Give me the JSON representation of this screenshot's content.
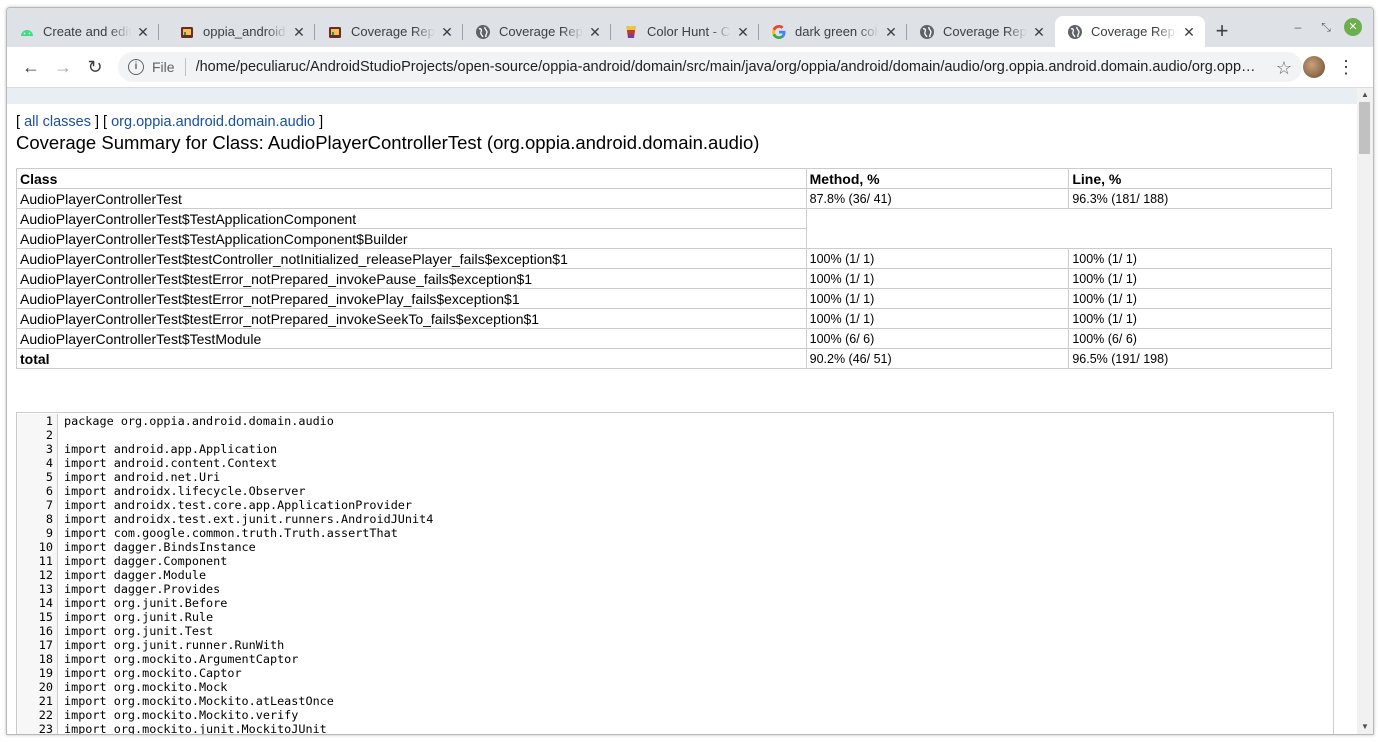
{
  "tabs": [
    {
      "title": "Create and edit",
      "icon": "android-icon"
    },
    {
      "title": "oppia_android",
      "icon": "oppia-icon"
    },
    {
      "title": "Coverage Report",
      "icon": "oppia-icon"
    },
    {
      "title": "Coverage Report",
      "icon": "globe-icon"
    },
    {
      "title": "Color Hunt - Color",
      "icon": "colorhunt-icon"
    },
    {
      "title": "dark green color",
      "icon": "google-icon"
    },
    {
      "title": "Coverage Report",
      "icon": "globe-icon"
    },
    {
      "title": "Coverage Report",
      "icon": "globe-icon",
      "active": true
    }
  ],
  "toolbar": {
    "file_label": "File",
    "url": "/home/peculiaruc/AndroidStudioProjects/open-source/oppia-android/domain/src/main/java/org/oppia/android/domain/audio/org.oppia.android.domain.audio/org.oppia.android.domain.audio.AudioPlayerControllerTest.html"
  },
  "breadcrumb": {
    "open": "[",
    "all_classes": "all classes",
    "mid": "] [",
    "package": "org.oppia.android.domain.audio",
    "close": "]"
  },
  "page_title": "Coverage Summary for Class: AudioPlayerControllerTest (org.oppia.android.domain.audio)",
  "table": {
    "headers": {
      "class": "Class",
      "method": "Method, %",
      "line": "Line, %"
    },
    "rows": [
      {
        "class": "AudioPlayerControllerTest",
        "method": "87.8% (36/ 41)",
        "line": "96.3% (181/ 188)"
      },
      {
        "class": "AudioPlayerControllerTest$TestApplicationComponent",
        "method": "",
        "line": ""
      },
      {
        "class": "AudioPlayerControllerTest$TestApplicationComponent$Builder",
        "method": "",
        "line": ""
      },
      {
        "class": "AudioPlayerControllerTest$testController_notInitialized_releasePlayer_fails$exception$1",
        "method": "100% (1/ 1)",
        "line": "100% (1/ 1)"
      },
      {
        "class": "AudioPlayerControllerTest$testError_notPrepared_invokePause_fails$exception$1",
        "method": "100% (1/ 1)",
        "line": "100% (1/ 1)"
      },
      {
        "class": "AudioPlayerControllerTest$testError_notPrepared_invokePlay_fails$exception$1",
        "method": "100% (1/ 1)",
        "line": "100% (1/ 1)"
      },
      {
        "class": "AudioPlayerControllerTest$testError_notPrepared_invokeSeekTo_fails$exception$1",
        "method": "100% (1/ 1)",
        "line": "100% (1/ 1)"
      },
      {
        "class": "AudioPlayerControllerTest$TestModule",
        "method": "100% (6/ 6)",
        "line": "100% (6/ 6)"
      }
    ],
    "total": {
      "class": "total",
      "method": "90.2% (46/ 51)",
      "line": "96.5% (191/ 198)"
    }
  },
  "code_lines": [
    {
      "n": "1",
      "text": "package org.oppia.android.domain.audio"
    },
    {
      "n": "2",
      "text": ""
    },
    {
      "n": "3",
      "text": "import android.app.Application"
    },
    {
      "n": "4",
      "text": "import android.content.Context"
    },
    {
      "n": "5",
      "text": "import android.net.Uri"
    },
    {
      "n": "6",
      "text": "import androidx.lifecycle.Observer"
    },
    {
      "n": "7",
      "text": "import androidx.test.core.app.ApplicationProvider"
    },
    {
      "n": "8",
      "text": "import androidx.test.ext.junit.runners.AndroidJUnit4"
    },
    {
      "n": "9",
      "text": "import com.google.common.truth.Truth.assertThat"
    },
    {
      "n": "10",
      "text": "import dagger.BindsInstance"
    },
    {
      "n": "11",
      "text": "import dagger.Component"
    },
    {
      "n": "12",
      "text": "import dagger.Module"
    },
    {
      "n": "13",
      "text": "import dagger.Provides"
    },
    {
      "n": "14",
      "text": "import org.junit.Before"
    },
    {
      "n": "15",
      "text": "import org.junit.Rule"
    },
    {
      "n": "16",
      "text": "import org.junit.Test"
    },
    {
      "n": "17",
      "text": "import org.junit.runner.RunWith"
    },
    {
      "n": "18",
      "text": "import org.mockito.ArgumentCaptor"
    },
    {
      "n": "19",
      "text": "import org.mockito.Captor"
    },
    {
      "n": "20",
      "text": "import org.mockito.Mock"
    },
    {
      "n": "21",
      "text": "import org.mockito.Mockito.atLeastOnce"
    },
    {
      "n": "22",
      "text": "import org.mockito.Mockito.verify"
    },
    {
      "n": "23",
      "text": "import org.mockito.junit.MockitoJUnit"
    }
  ],
  "colors": {
    "link": "#1a4fa0",
    "tabstrip": "#dee1e6",
    "window_close": "#6ab04c"
  }
}
